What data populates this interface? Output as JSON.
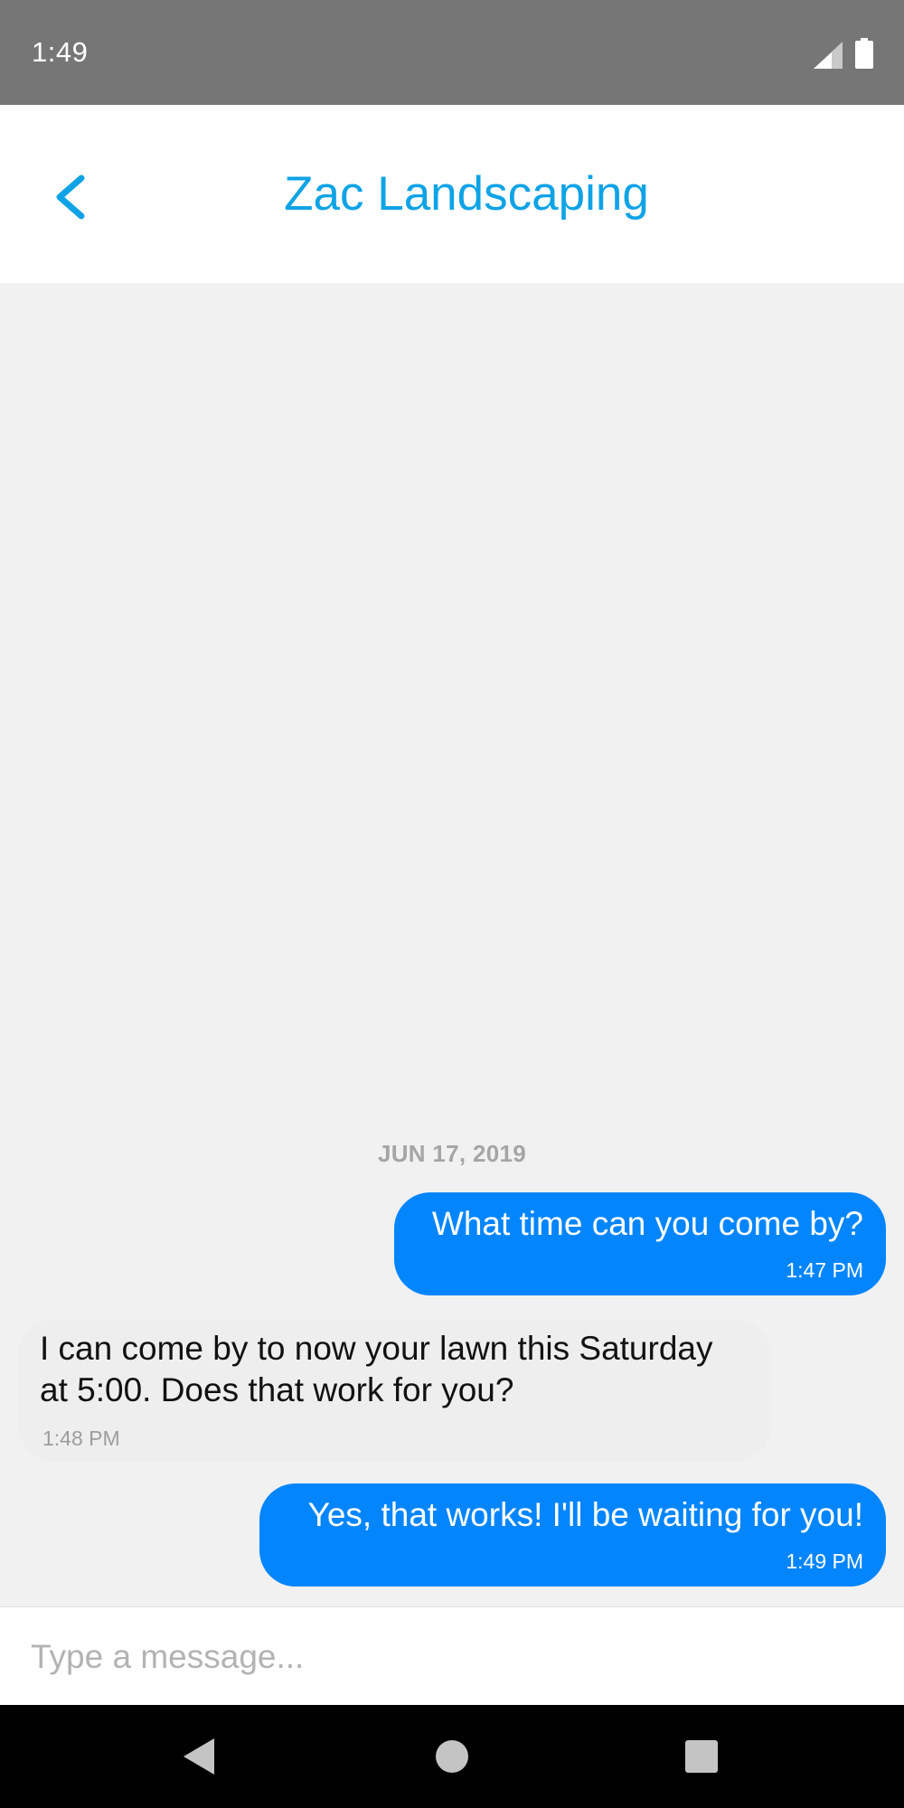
{
  "status_bar": {
    "time": "1:49",
    "icons": [
      "signal-icon",
      "battery-icon"
    ]
  },
  "header": {
    "title": "Zac Landscaping",
    "back_icon": "chevron-left-icon"
  },
  "chat": {
    "date_separator": "JUN 17, 2019",
    "messages": [
      {
        "direction": "outgoing",
        "text": "What time can you come by?",
        "time": "1:47 PM"
      },
      {
        "direction": "incoming",
        "lines": [
          "I can come by to now your lawn this Saturday",
          "at 5:00. Does that work for you?"
        ],
        "time": "1:48 PM"
      },
      {
        "direction": "outgoing",
        "text": "Yes, that works! I'll be waiting for you!",
        "time": "1:49 PM"
      }
    ]
  },
  "composer": {
    "placeholder": "Type a message...",
    "value": ""
  },
  "nav_bar": {
    "buttons": [
      "back-triangle-icon",
      "home-circle-icon",
      "recents-square-icon"
    ]
  },
  "colors": {
    "accent": "#0fa3e6",
    "outgoing_bubble": "#0285fd",
    "incoming_bubble": "#eeeeee",
    "status_bar": "#767676",
    "chat_background": "#f1f1f1"
  }
}
